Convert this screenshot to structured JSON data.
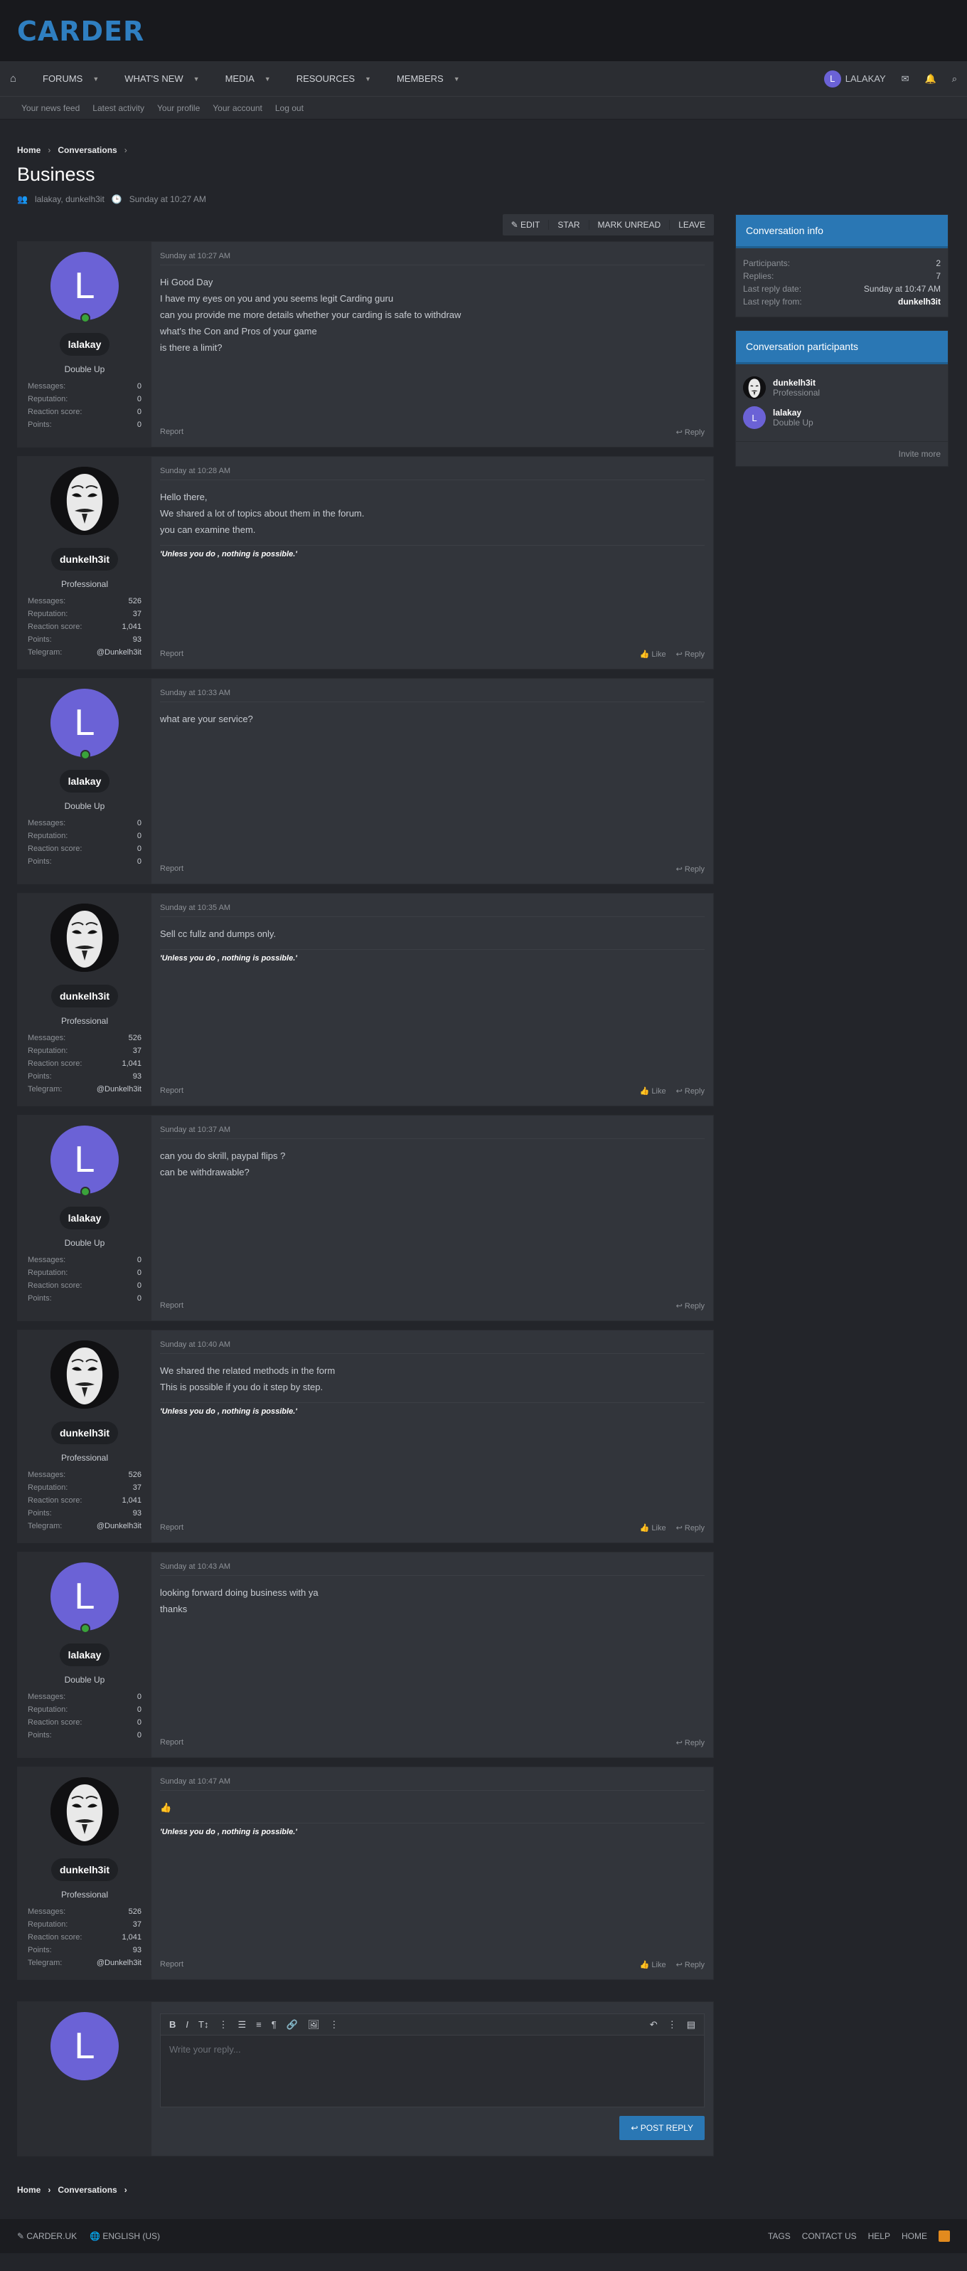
{
  "site": {
    "logo": "CARDER"
  },
  "nav": {
    "items": [
      "FORUMS",
      "WHAT'S NEW",
      "MEDIA",
      "RESOURCES",
      "MEMBERS"
    ],
    "user": "LALAKAY",
    "user_initial": "L"
  },
  "subnav": [
    "Your news feed",
    "Latest activity",
    "Your profile",
    "Your account",
    "Log out"
  ],
  "breadcrumb": {
    "home": "Home",
    "conversations": "Conversations"
  },
  "page": {
    "title": "Business",
    "participants": "lalakay, dunkelh3it",
    "date": "Sunday at 10:27 AM"
  },
  "actions": [
    "EDIT",
    "STAR",
    "MARK UNREAD",
    "LEAVE"
  ],
  "labels": {
    "messages": "Messages:",
    "reputation": "Reputation:",
    "reaction": "Reaction score:",
    "points": "Points:",
    "telegram": "Telegram:",
    "report": "Report",
    "like": "Like",
    "reply": "Reply"
  },
  "users": {
    "lalakay": {
      "name": "lalakay",
      "title": "Double Up",
      "initial": "L",
      "messages": "0",
      "reputation": "0",
      "reaction": "0",
      "points": "0"
    },
    "dunkelh3it": {
      "name": "dunkelh3it",
      "title": "Professional",
      "messages": "526",
      "reputation": "37",
      "reaction": "1,041",
      "points": "93",
      "telegram": "@Dunkelh3it"
    }
  },
  "signature": "'Unless you do , nothing is possible.'",
  "posts": [
    {
      "user": "lalakay",
      "date": "Sunday at 10:27 AM",
      "lines": [
        "Hi Good Day",
        "I have my eyes on you and you seems legit Carding guru",
        "can you provide me more details whether your carding is safe to withdraw",
        "what's the Con and Pros of your game",
        "is there a limit?"
      ]
    },
    {
      "user": "dunkelh3it",
      "date": "Sunday at 10:28 AM",
      "lines": [
        "Hello there,",
        "We shared a lot of topics about them in the forum.",
        "you can examine them."
      ]
    },
    {
      "user": "lalakay",
      "date": "Sunday at 10:33 AM",
      "lines": [
        "what are your service?"
      ]
    },
    {
      "user": "dunkelh3it",
      "date": "Sunday at 10:35 AM",
      "lines": [
        "Sell cc fullz and dumps only."
      ]
    },
    {
      "user": "lalakay",
      "date": "Sunday at 10:37 AM",
      "lines": [
        "can you do skrill, paypal flips ?",
        "can be withdrawable?"
      ]
    },
    {
      "user": "dunkelh3it",
      "date": "Sunday at 10:40 AM",
      "lines": [
        "We shared the related methods in the form",
        "This is possible if you do it step by step."
      ]
    },
    {
      "user": "lalakay",
      "date": "Sunday at 10:43 AM",
      "lines": [
        "looking forward doing business with ya",
        "thanks"
      ]
    },
    {
      "user": "dunkelh3it",
      "date": "Sunday at 10:47 AM",
      "lines": [
        "👍"
      ]
    }
  ],
  "sidebar": {
    "info_title": "Conversation info",
    "info": [
      {
        "k": "Participants:",
        "v": "2"
      },
      {
        "k": "Replies:",
        "v": "7"
      },
      {
        "k": "Last reply date:",
        "v": "Sunday at 10:47 AM"
      },
      {
        "k": "Last reply from:",
        "v": "dunkelh3it"
      }
    ],
    "participants_title": "Conversation participants",
    "participants": [
      {
        "name": "dunkelh3it",
        "title": "Professional"
      },
      {
        "name": "lalakay",
        "title": "Double Up"
      }
    ],
    "invite": "Invite more"
  },
  "reply": {
    "placeholder": "Write your reply...",
    "button": "POST REPLY"
  },
  "footer": {
    "left": [
      "CARDER.UK",
      "ENGLISH (US)"
    ],
    "right": [
      "TAGS",
      "CONTACT US",
      "HELP",
      "HOME"
    ]
  },
  "colors": {
    "accent": "#2a77b4",
    "avatar_purple": "#6b62d6",
    "online": "#3aa33a"
  }
}
